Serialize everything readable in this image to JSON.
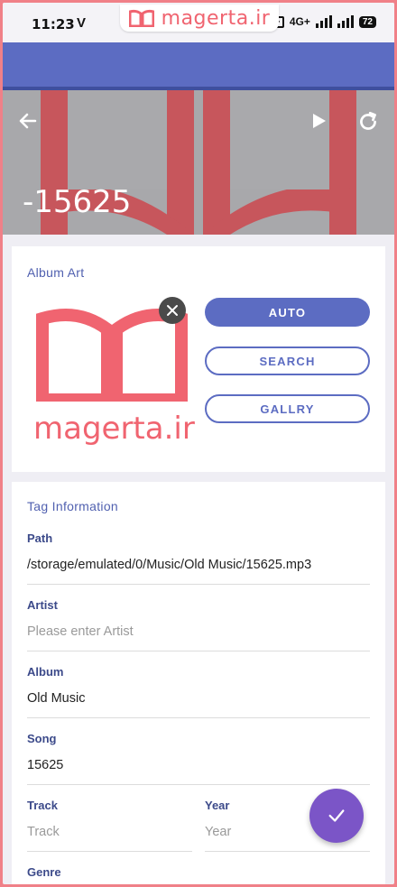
{
  "status_bar": {
    "time": "11:23",
    "carrier_glyph": "V",
    "network": "4G+",
    "battery": "72"
  },
  "watermark": {
    "text": "magerta.ir",
    "color": "#f06470"
  },
  "header": {
    "title": "-15625"
  },
  "album_art": {
    "section_title": "Album Art",
    "image_text": "magerta.ir",
    "buttons": {
      "auto": "AUTO",
      "search": "SEARCH",
      "gallery": "GALLRY"
    }
  },
  "tag_info": {
    "section_title": "Tag Information",
    "path": {
      "label": "Path",
      "value": "/storage/emulated/0/Music/Old Music/15625.mp3"
    },
    "artist": {
      "label": "Artist",
      "placeholder": "Please enter Artist"
    },
    "album": {
      "label": "Album",
      "value": "Old Music"
    },
    "song": {
      "label": "Song",
      "value": "15625"
    },
    "track": {
      "label": "Track",
      "placeholder": "Track"
    },
    "year": {
      "label": "Year",
      "placeholder": "Year"
    },
    "genre": {
      "label": "Genre"
    }
  },
  "colors": {
    "primary": "#5c6cc2",
    "fab": "#7b55c7",
    "brand_red": "#f06470"
  },
  "icons": {
    "back": "arrow-left-icon",
    "play": "play-icon",
    "refresh": "refresh-icon",
    "close": "close-icon",
    "save": "check-icon"
  }
}
